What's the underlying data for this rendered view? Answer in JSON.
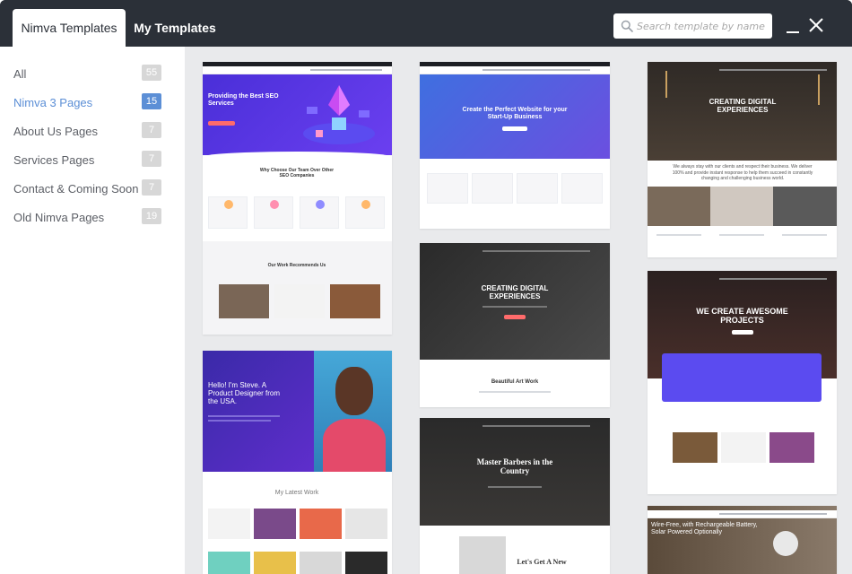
{
  "header": {
    "tabs": [
      {
        "label": "Nimva Templates",
        "active": true
      },
      {
        "label": "My Templates",
        "active": false
      }
    ],
    "search": {
      "placeholder": "Search template by name",
      "value": ""
    },
    "icons": {
      "search": "search-icon",
      "minimize": "minimize-icon",
      "close": "close-icon"
    }
  },
  "sidebar": {
    "categories": [
      {
        "label": "All",
        "count": "55"
      },
      {
        "label": "Nimva 3 Pages",
        "count": "15",
        "active": true
      },
      {
        "label": "About Us Pages",
        "count": "7"
      },
      {
        "label": "Services Pages",
        "count": "7"
      },
      {
        "label": "Contact & Coming Soon",
        "count": "7"
      },
      {
        "label": "Old Nimva Pages",
        "count": "19"
      }
    ]
  },
  "templates": {
    "seo": {
      "hero_title": "Providing the Best SEO Services",
      "section_title": "Why Choose Our Team Over Other SEO Companies",
      "work_title": "Our Work Recommends Us"
    },
    "startup": {
      "hero_title": "Create the Perfect Website for your Start-Up Business"
    },
    "digital": {
      "hero_title": "CREATING DIGITAL EXPERIENCES",
      "intro": "We always stay with our clients and respect their business. We deliver 100% and provide instant response to help them succeed in constantly changing and challenging business world."
    },
    "artwork": {
      "hero_title": "CREATING DIGITAL EXPERIENCES",
      "section_title": "Beautiful Art Work"
    },
    "awesome": {
      "hero_title": "WE CREATE AWESOME PROJECTS"
    },
    "designer": {
      "hero_title": "Hello! I'm Steve. A Product Designer from the USA.",
      "section_title": "My Latest Work"
    },
    "barbers": {
      "hero_title": "Master Barbers in the Country",
      "section_title": "Let's Get A New"
    },
    "camera": {
      "hero_title": "Wire-Free, with Rechargeable Battery, Solar Powered Optionally"
    }
  },
  "colors": {
    "header_bg": "#2b3038",
    "accent": "#5c8fd6",
    "badge": "#d7d7d7",
    "content_bg": "#e9eaec"
  }
}
